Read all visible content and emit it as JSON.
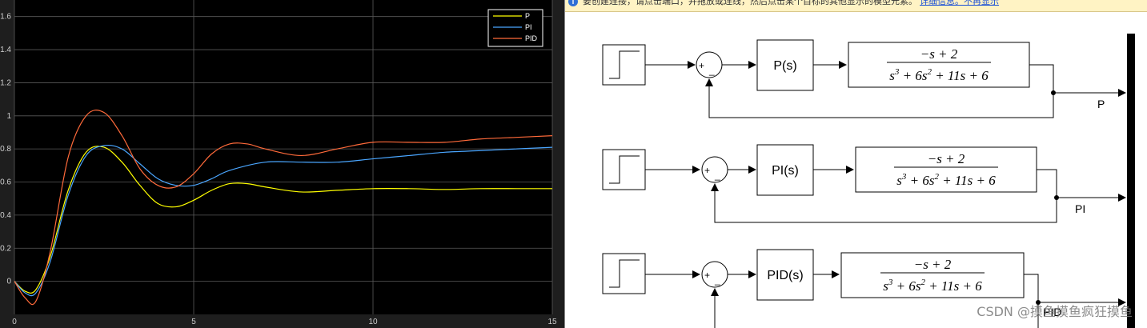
{
  "scope": {
    "y_ticks": [
      "0",
      "0.2",
      "0.4",
      "0.6",
      "0.8",
      "1",
      "1.2",
      "1.4",
      "1.6"
    ],
    "x_ticks": [
      "0",
      "5",
      "10",
      "15"
    ],
    "legend": [
      {
        "label": "P",
        "color": "#ffff00"
      },
      {
        "label": "PI",
        "color": "#4aa6ff"
      },
      {
        "label": "PID",
        "color": "#ff6a3a"
      }
    ]
  },
  "chart_data": {
    "type": "line",
    "title": "",
    "xlabel": "",
    "ylabel": "",
    "xlim": [
      0,
      15
    ],
    "ylim": [
      -0.2,
      1.7
    ],
    "grid": true,
    "legend_position": "top-right",
    "series": [
      {
        "name": "P",
        "color": "#ffff00",
        "x": [
          0,
          0.3,
          0.6,
          1.0,
          1.5,
          2.0,
          2.5,
          3.0,
          3.5,
          4.0,
          4.5,
          5.0,
          5.5,
          6.0,
          6.5,
          7.0,
          8.0,
          9.0,
          10.0,
          11.0,
          12.0,
          13.0,
          14.0,
          15.0
        ],
        "y": [
          0,
          -0.06,
          -0.05,
          0.15,
          0.55,
          0.78,
          0.81,
          0.72,
          0.58,
          0.47,
          0.45,
          0.49,
          0.55,
          0.59,
          0.59,
          0.57,
          0.54,
          0.55,
          0.56,
          0.56,
          0.555,
          0.56,
          0.56,
          0.56
        ]
      },
      {
        "name": "PI",
        "color": "#4aa6ff",
        "x": [
          0,
          0.3,
          0.6,
          1.0,
          1.5,
          2.0,
          2.5,
          3.0,
          3.5,
          4.0,
          4.5,
          5.0,
          5.5,
          6.0,
          7.0,
          8.0,
          9.0,
          10.0,
          11.0,
          12.0,
          13.0,
          14.0,
          15.0
        ],
        "y": [
          0,
          -0.07,
          -0.07,
          0.12,
          0.52,
          0.76,
          0.82,
          0.8,
          0.71,
          0.62,
          0.58,
          0.58,
          0.62,
          0.67,
          0.72,
          0.72,
          0.72,
          0.74,
          0.76,
          0.78,
          0.79,
          0.8,
          0.81
        ]
      },
      {
        "name": "PID",
        "color": "#ff6a3a",
        "x": [
          0,
          0.3,
          0.6,
          1.0,
          1.5,
          2.0,
          2.5,
          3.0,
          3.5,
          4.0,
          4.5,
          5.0,
          5.5,
          6.0,
          6.5,
          7.0,
          8.0,
          9.0,
          10.0,
          11.0,
          12.0,
          13.0,
          14.0,
          15.0
        ],
        "y": [
          0,
          -0.1,
          -0.12,
          0.18,
          0.75,
          1.0,
          1.02,
          0.88,
          0.68,
          0.58,
          0.57,
          0.65,
          0.77,
          0.83,
          0.83,
          0.8,
          0.76,
          0.8,
          0.84,
          0.84,
          0.84,
          0.86,
          0.87,
          0.88
        ]
      }
    ]
  },
  "infobar": {
    "text": "要创建连接，请点击端口，并拖放或连线，然后点击某个目标的其他显示的模型元素。",
    "link": "详细信息。不再显示"
  },
  "model": {
    "rows": [
      {
        "controller": "P(s)",
        "signal": "P"
      },
      {
        "controller": "PI(s)",
        "signal": "PI"
      },
      {
        "controller": "PID(s)",
        "signal": "PID"
      }
    ],
    "plant": {
      "numerator": "−s + 2",
      "den_s3": "s",
      "den_exp3": "3",
      "den_mid": " + 6s",
      "den_exp2": "2",
      "den_tail": " + 11s + 6"
    },
    "sum_plus": "+",
    "sum_minus": "_"
  },
  "watermark": "CSDN @摸鱼摸鱼疯狂摸鱼"
}
